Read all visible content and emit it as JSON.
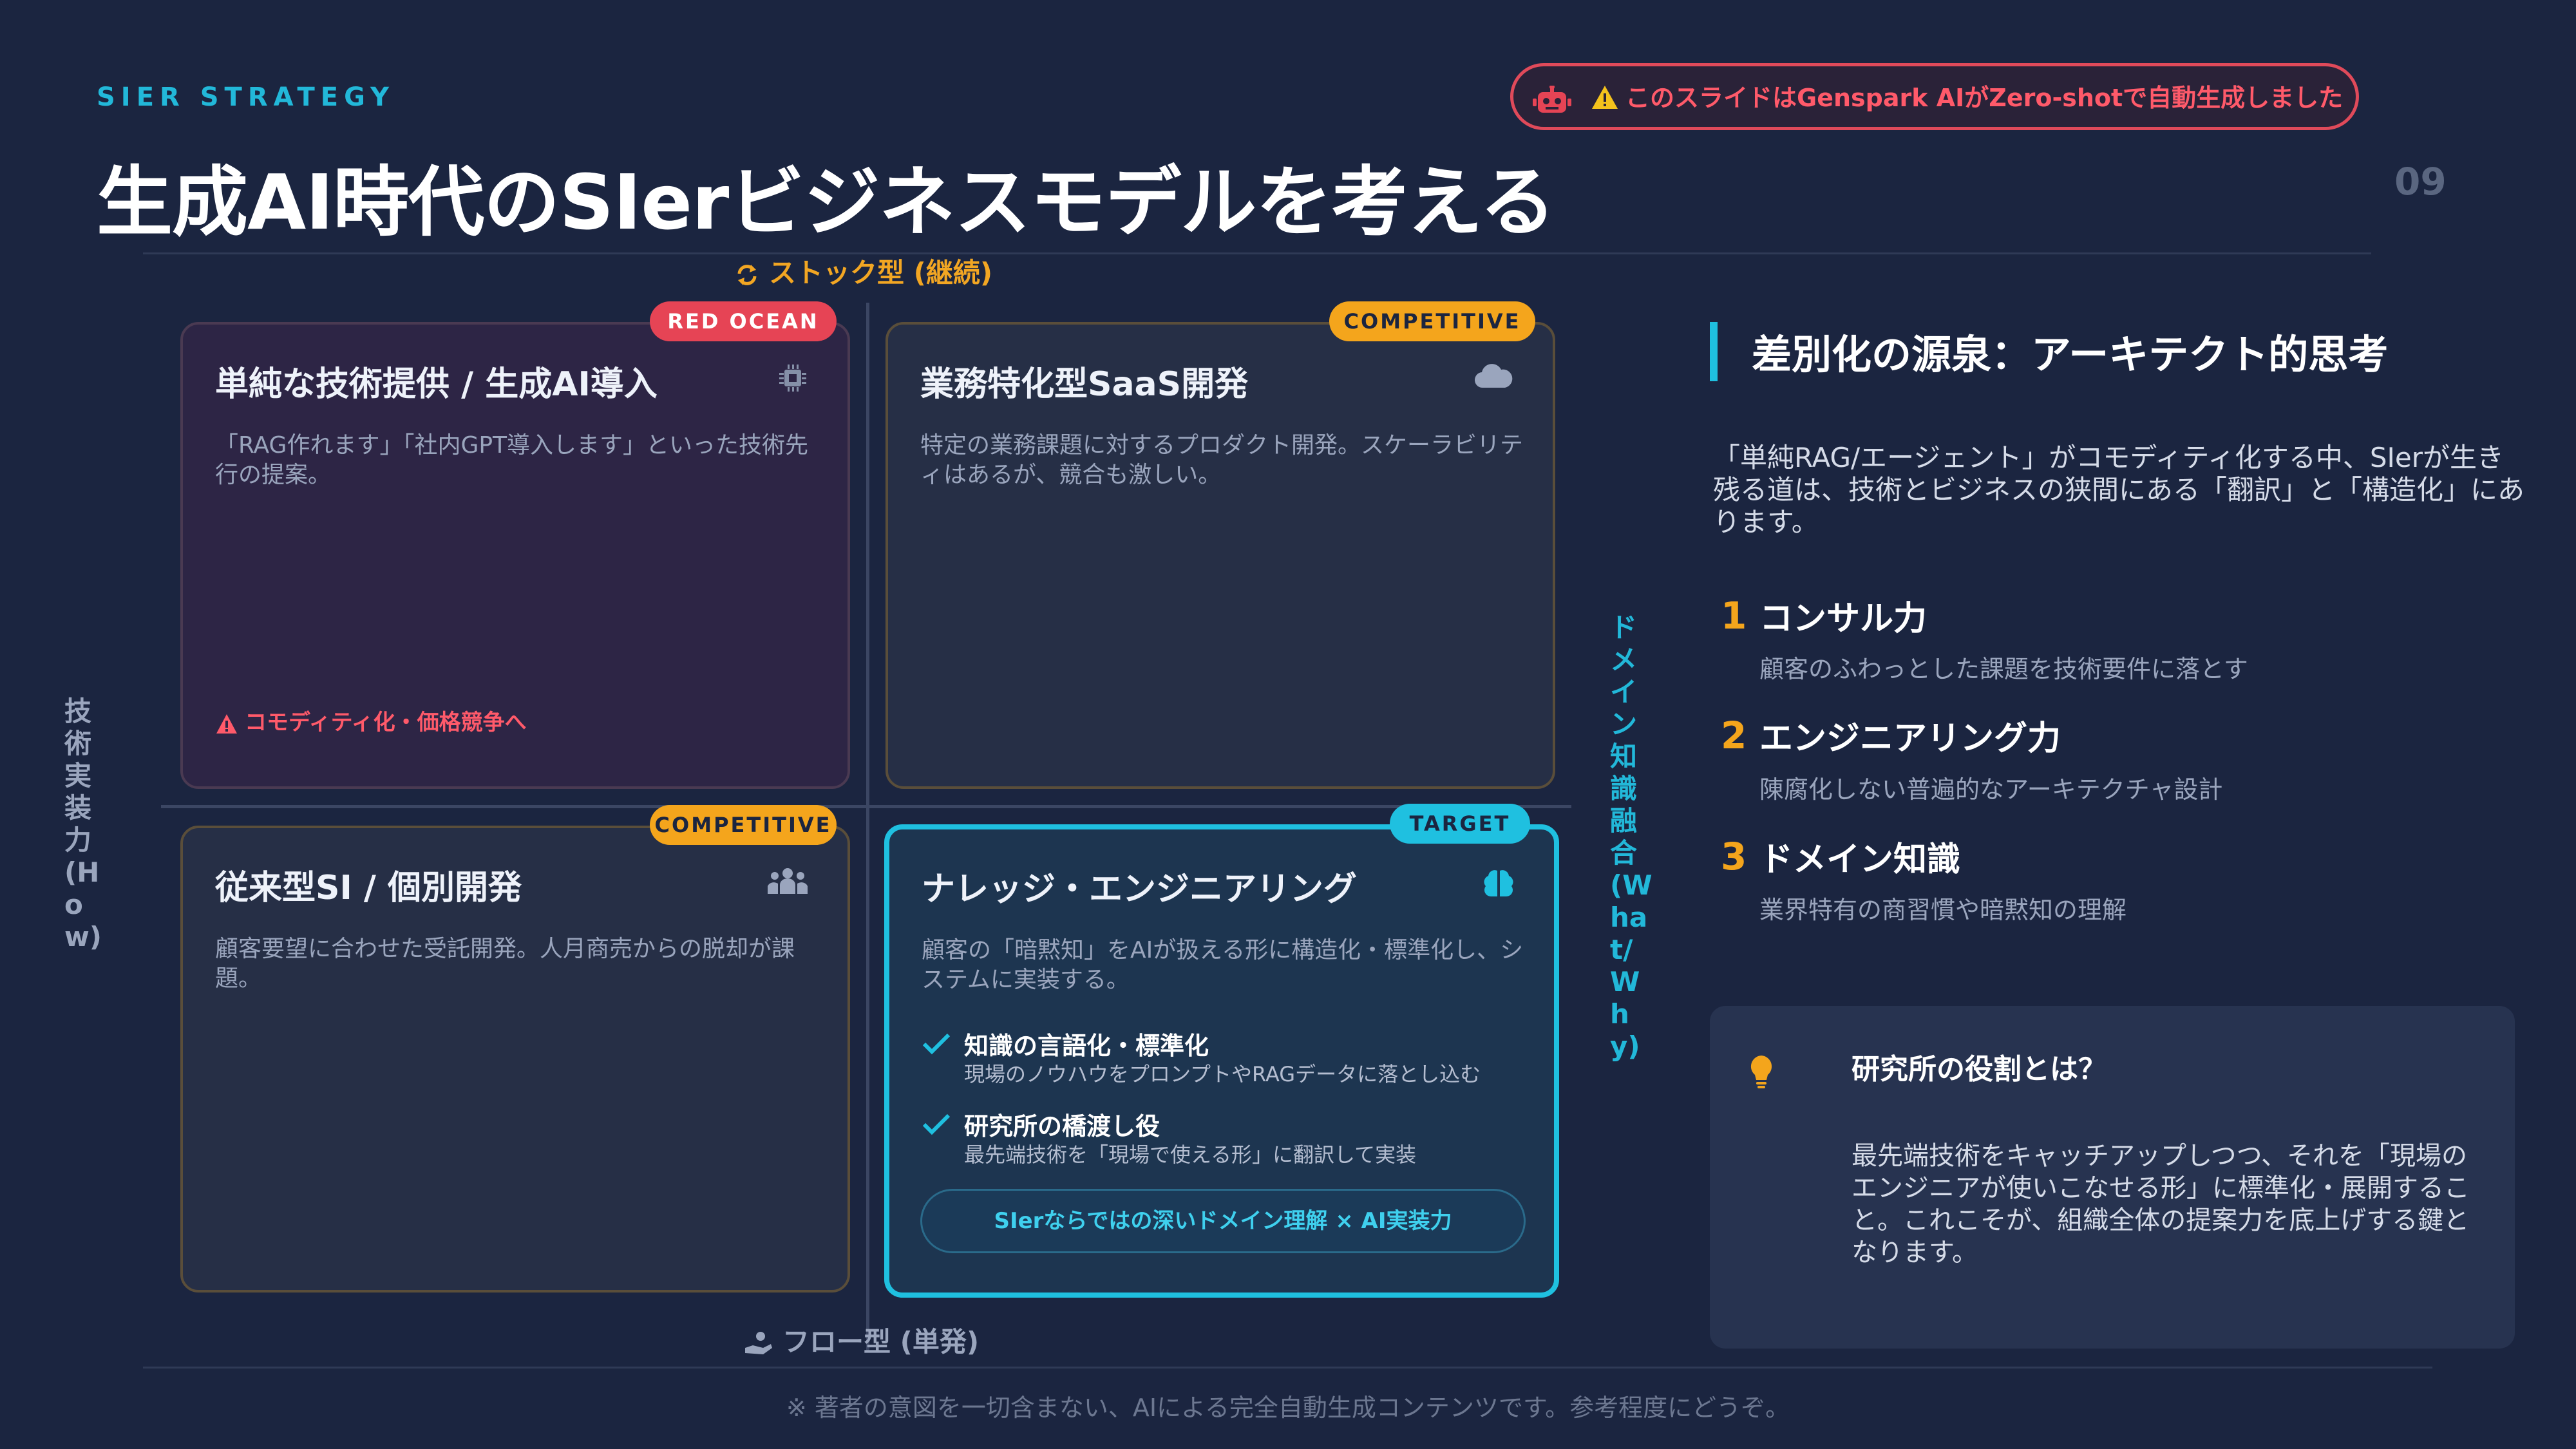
{
  "header": {
    "eyebrow": "SIER STRATEGY",
    "title": "生成AI時代のSIerビジネスモデルを考える",
    "notice": "このスライドはGenspark AIがZero-shotで自動生成しました",
    "page_number": "09"
  },
  "axes": {
    "top": "ストック型 (継続)",
    "bottom": "フロー型 (単発)",
    "left": "技術実装力(How)",
    "right": "ドメイン知識融合(What/Why)"
  },
  "quadrants": {
    "top_left": {
      "badge": "RED OCEAN",
      "title": "単純な技術提供 / 生成AI導入",
      "desc": "「RAG作れます」「社内GPT導入します」といった技術先行の提案。",
      "warning": "コモディティ化・価格競争へ",
      "icon": "chip-icon"
    },
    "top_right": {
      "badge": "COMPETITIVE",
      "title": "業務特化型SaaS開発",
      "desc": "特定の業務課題に対するプロダクト開発。スケーラビリティはあるが、競合も激しい。",
      "icon": "cloud-icon"
    },
    "bottom_left": {
      "badge": "COMPETITIVE",
      "title": "従来型SI / 個別開発",
      "desc": "顧客要望に合わせた受託開発。人月商売からの脱却が課題。",
      "icon": "people-icon"
    },
    "bottom_right": {
      "badge": "TARGET",
      "title": "ナレッジ・エンジニアリング",
      "desc": "顧客の「暗黙知」をAIが扱える形に構造化・標準化し、システムに実装する。",
      "icon": "brain-icon",
      "checks": [
        {
          "title": "知識の言語化・標準化",
          "sub": "現場のノウハウをプロンプトやRAGデータに落とし込む"
        },
        {
          "title": "研究所の橋渡し役",
          "sub": "最先端技術を「現場で使える形」に翻訳して実装"
        }
      ],
      "pill": "SIerならではの深いドメイン理解 × AI実装力"
    }
  },
  "right_panel": {
    "title": "差別化の源泉：アーキテクト的思考",
    "desc": "「単純RAG/エージェント」がコモディティ化する中、SIerが生き残る道は、技術とビジネスの狭間にある「翻訳」と「構造化」にあります。",
    "items": [
      {
        "num": "1",
        "title": "コンサル力",
        "desc": "顧客のふわっとした課題を技術要件に落とす"
      },
      {
        "num": "2",
        "title": "エンジニアリング力",
        "desc": "陳腐化しない普遍的なアーキテクチャ設計"
      },
      {
        "num": "3",
        "title": "ドメイン知識",
        "desc": "業界特有の商習慣や暗黙知の理解"
      }
    ],
    "lab": {
      "title": "研究所の役割とは？",
      "body": "最先端技術をキャッチアップしつつ、それを「現場のエンジニアが使いこなせる形」に標準化・展開すること。これこそが、組織全体の提案力を底上げする鍵となります。"
    }
  },
  "footer": "※ 著者の意図を一切含まない、AIによる完全自動生成コンテンツです。参考程度にどうぞ。",
  "colors": {
    "background": "#1b2540",
    "accent_cyan": "#1fc0e0",
    "accent_orange": "#f4a51c",
    "accent_red": "#e64455"
  }
}
